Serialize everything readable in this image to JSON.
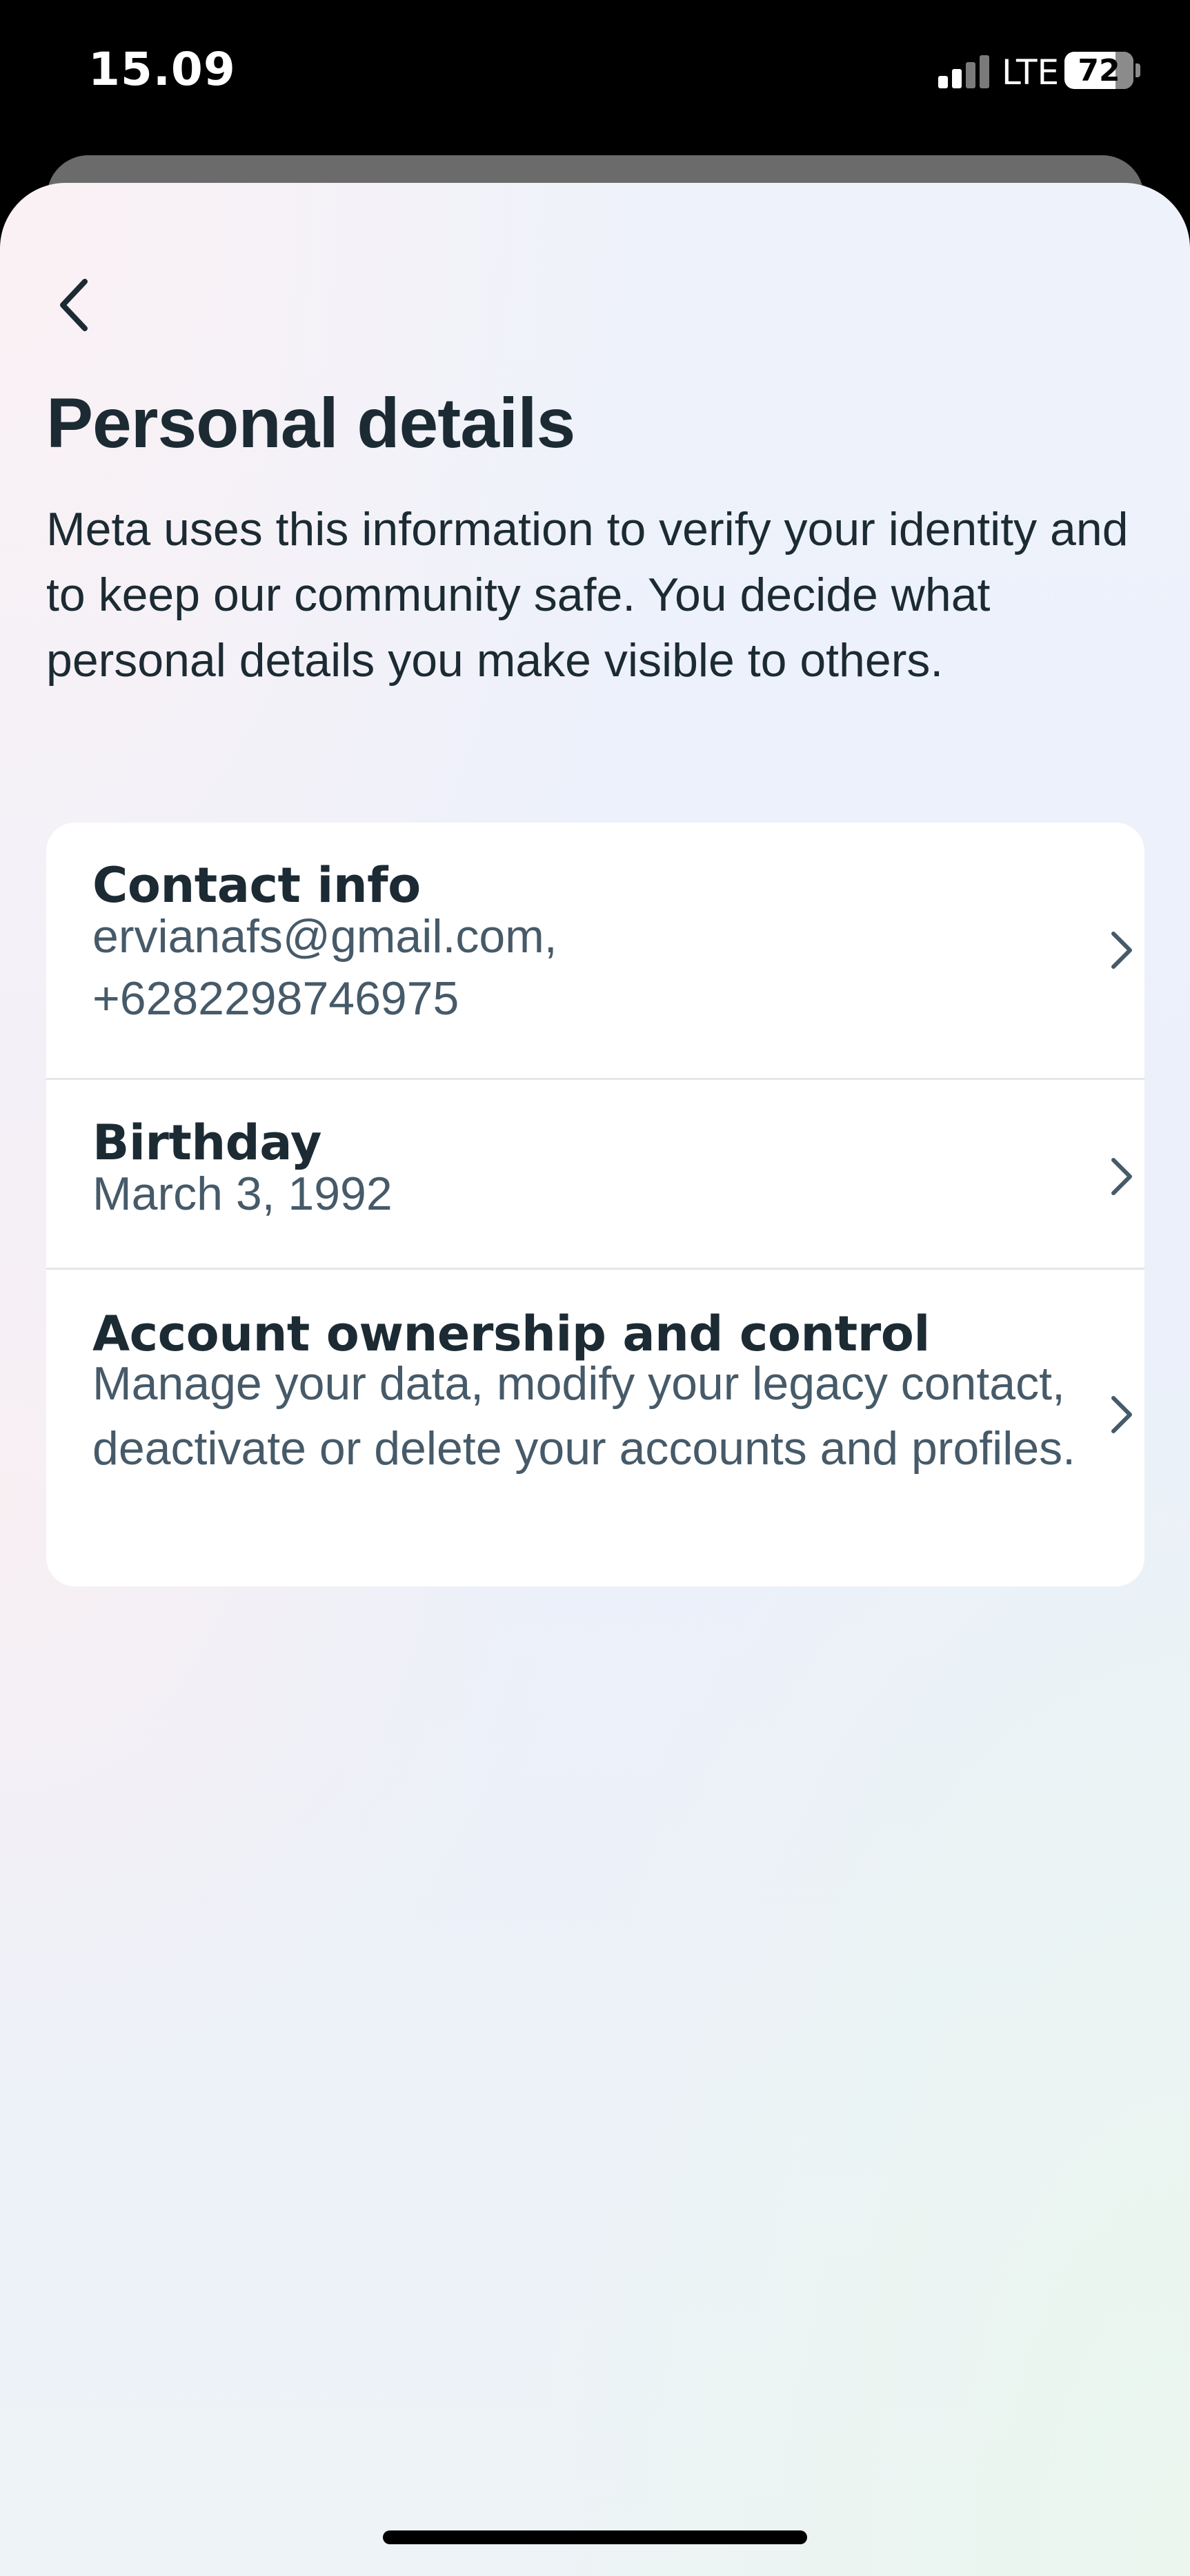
{
  "status_bar": {
    "time": "15.09",
    "network": "LTE",
    "battery": "72"
  },
  "header": {
    "title": "Personal details",
    "description": "Meta uses this information to verify your identity and to keep our community safe. You decide what personal details you make visible to others."
  },
  "details": {
    "contact": {
      "label": "Contact info",
      "email": "ervianafs@gmail.com,",
      "phone": "+6282298746975"
    },
    "birthday": {
      "label": "Birthday",
      "value": "March 3, 1992"
    },
    "ownership": {
      "label": "Account ownership and control",
      "description": "Manage your data, modify your legacy contact, deactivate or delete your accounts and profiles."
    }
  },
  "icons": {
    "back": "chevron-left-icon",
    "row_arrow": "chevron-right-icon"
  },
  "colors": {
    "primary_text": "#1c2b33",
    "secondary_text": "#465a69",
    "card_background": "#ffffff"
  }
}
